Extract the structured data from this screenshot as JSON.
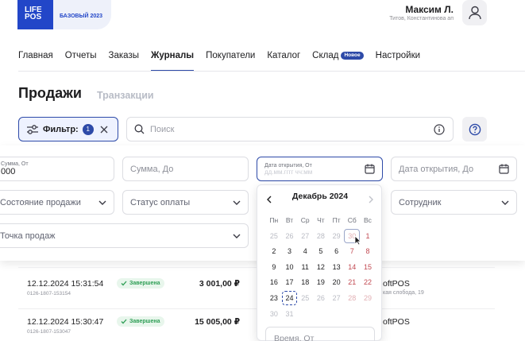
{
  "header": {
    "logo_line1": "LIFE",
    "logo_line2": "POS",
    "plan": "БАЗОВЫЙ 2023",
    "user_name": "Максим Л.",
    "user_company": "Титов, Константинова ап"
  },
  "nav": {
    "items": [
      {
        "label": "Главная"
      },
      {
        "label": "Отчеты"
      },
      {
        "label": "Заказы"
      },
      {
        "label": "Журналы",
        "active": true
      },
      {
        "label": "Покупатели"
      },
      {
        "label": "Каталог"
      },
      {
        "label": "Склад",
        "badge": "Новое"
      },
      {
        "label": "Настройки"
      }
    ]
  },
  "page": {
    "title": "Продажи",
    "tab_secondary": "Транзакции"
  },
  "toolbar": {
    "filter_label": "Фильтр:",
    "filter_count": "1",
    "search_placeholder": "Поиск"
  },
  "filters": {
    "sum_from_label": "Сумма, От",
    "sum_from_value": "000",
    "sum_to_placeholder": "Сумма, До",
    "open_date_from_label": "Дата открытия, От",
    "open_date_from_placeholder": "дд.мм.гггг чч:мм",
    "open_date_to_placeholder": "Дата открытия, До",
    "sale_state": "Состояние продажи",
    "payment_status": "Статус оплаты",
    "employee": "Сотрудник",
    "point_of_sale": "Точка продаж"
  },
  "calendar": {
    "month": "Декабрь 2024",
    "weekdays": [
      "Пн",
      "Вт",
      "Ср",
      "Чт",
      "Пт",
      "Сб",
      "Вс"
    ],
    "weeks": [
      [
        "25",
        "26",
        "27",
        "28",
        "29",
        "30",
        "1"
      ],
      [
        "2",
        "3",
        "4",
        "5",
        "6",
        "7",
        "8"
      ],
      [
        "9",
        "10",
        "11",
        "12",
        "13",
        "14",
        "15"
      ],
      [
        "16",
        "17",
        "18",
        "19",
        "20",
        "21",
        "22"
      ],
      [
        "23",
        "24",
        "25",
        "26",
        "27",
        "28",
        "29"
      ],
      [
        "30",
        "31",
        "",
        "",
        "",
        "",
        ""
      ]
    ],
    "time_from_placeholder": "Время, От"
  },
  "sales": [
    {
      "datetime": "12.12.2024 15:31:54",
      "id": "0126-1807-153154",
      "status": "Завершена",
      "amount": "3 001,00 ₽",
      "shop": "oftPOS",
      "address": "кая слобода, 19"
    },
    {
      "datetime": "12.12.2024 15:30:47",
      "id": "0126-1807-153047",
      "status": "Завершена",
      "amount": "15 005,00 ₽",
      "shop": "oftPOS",
      "address": ""
    }
  ],
  "colors": {
    "brand": "#2246c8",
    "accent": "#2d4aa8",
    "success": "#2e9e55",
    "weekend": "#c24a52"
  }
}
